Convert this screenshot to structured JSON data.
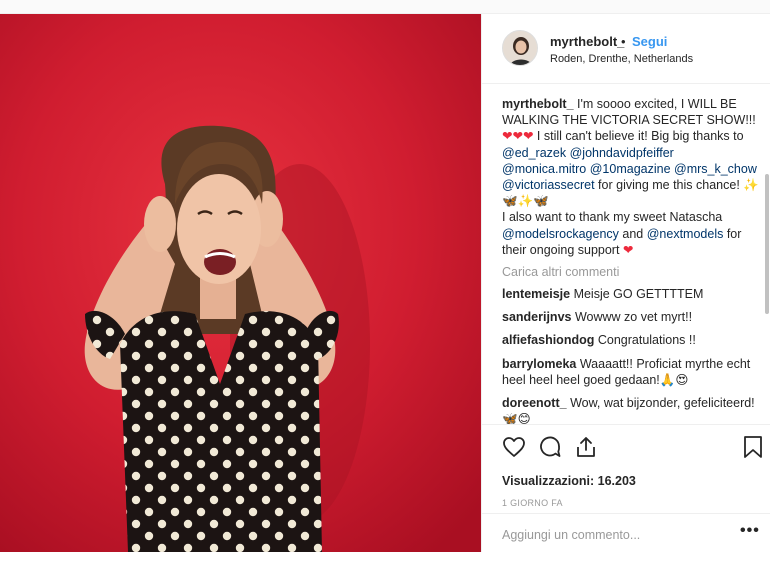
{
  "post": {
    "header": {
      "username": "myrthebolt_",
      "separator": "•",
      "follow_label": "Segui",
      "location": "Roden, Drenthe, Netherlands"
    },
    "caption": {
      "username": "myrthebolt_",
      "text1": " I'm soooo excited, I WILL BE WALKING THE VICTORIA SECRET SHOW!!! ",
      "hearts1": "❤❤❤",
      "text2": " I still can't believe it! Big big thanks to ",
      "mention1": "@ed_razek",
      "mention2": "@johndavidpfeiffer",
      "mention3": "@monica.mitro",
      "mention4": "@10magazine",
      "mention5": "@mrs_k_chow",
      "mention6": "@victoriassecret",
      "text3": " for giving me this chance! ",
      "wings": "✨🦋✨🦋",
      "text4": "I also want to thank my sweet Natascha ",
      "mention7": "@modelsrockagency",
      "text5": " and ",
      "mention8": "@nextmodels",
      "text6": " for their ongoing support ",
      "heart_end": "❤"
    },
    "load_more": "Carica altri commenti",
    "comments": [
      {
        "user": "lentemeisje",
        "text": " Meisje GO GETTTTEM"
      },
      {
        "user": "sanderijnvs",
        "text": " Wowww zo vet myrt!!"
      },
      {
        "user": "alfiefashiondog",
        "text": " Congratulations !!"
      },
      {
        "user": "barrylomeka",
        "text": " Waaaatt!! Proficiat myrthe echt heel heel heel goed gedaan!🙏😍"
      },
      {
        "user": "doreenott_",
        "text": " Wow, wat bijzonder, gefeliciteerd! 🦋😊"
      }
    ],
    "views_label": "Visualizzazioni: 16.203",
    "time_ago": "1 GIORNO FA",
    "add_comment_placeholder": "Aggiungi un commento...",
    "more_label": "•••"
  },
  "icons": {
    "like": "heart-outline-icon",
    "comment": "speech-bubble-icon",
    "share": "share-upload-icon",
    "save": "bookmark-icon"
  },
  "colors": {
    "background_red": "#d21c30",
    "link_blue": "#3897f0",
    "mention_blue": "#003569",
    "heart_red": "#ed2a3c"
  }
}
